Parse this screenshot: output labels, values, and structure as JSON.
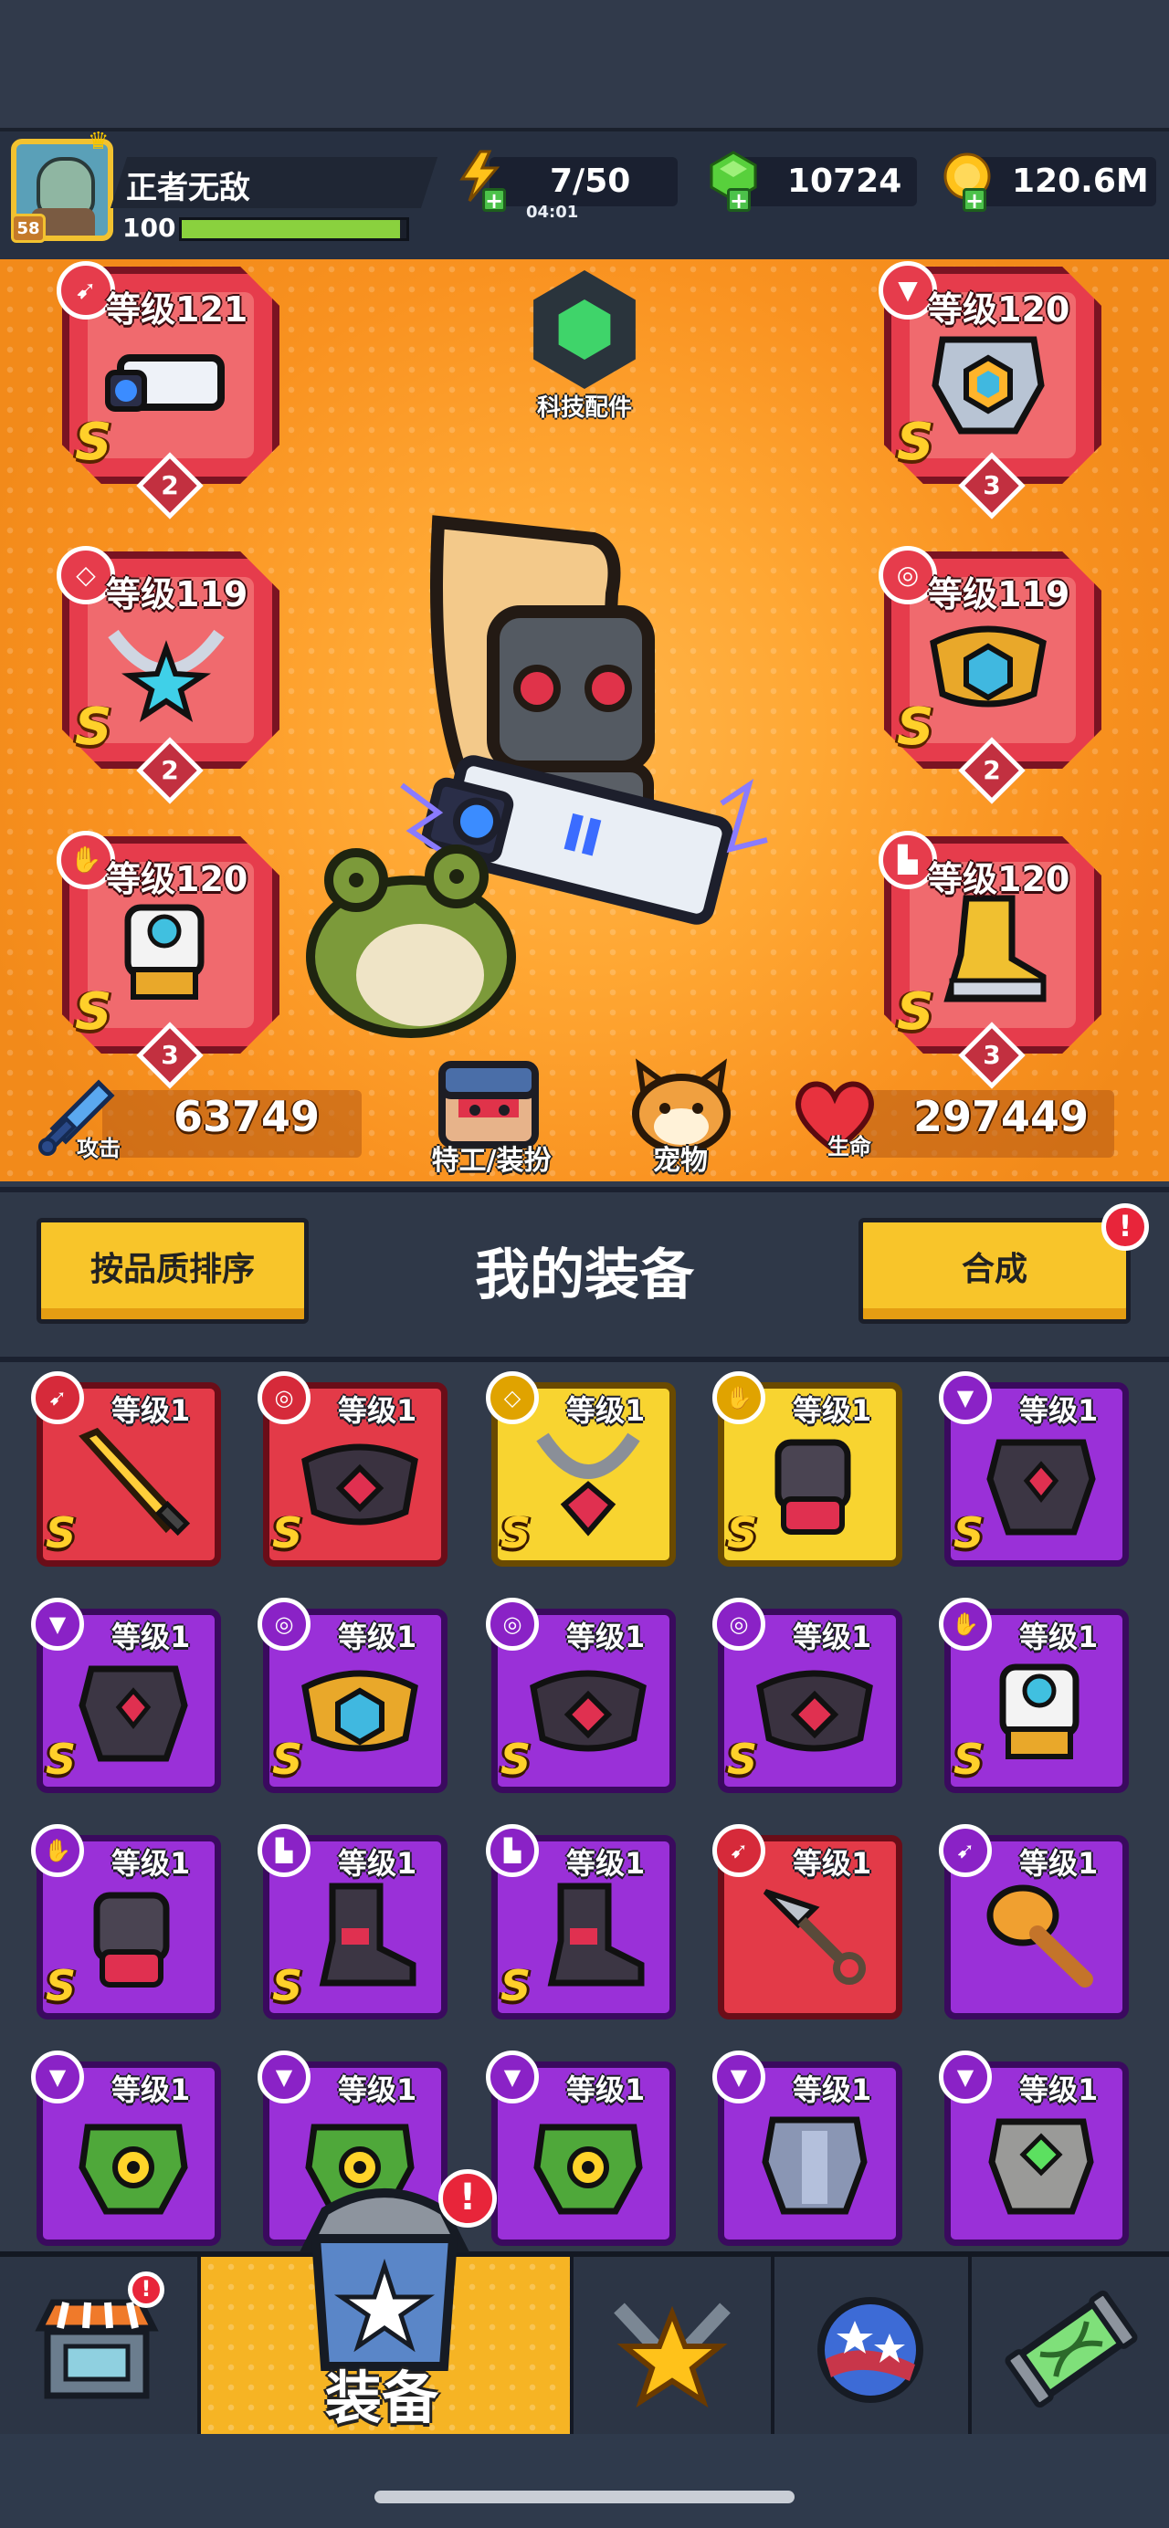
{
  "player": {
    "name": "正者无敌",
    "avatar_level": "58",
    "xp_level": "100",
    "xp_progress": 0.97
  },
  "resources": {
    "energy": "7/50",
    "energy_timer": "04:01",
    "gems": "10724",
    "coins": "120.6M"
  },
  "hero": {
    "tech_label": "科技配件",
    "attack_label": "攻击",
    "attack_value": "63749",
    "agent_label": "特工/装扮",
    "pet_label": "宠物",
    "hp_label": "生命",
    "hp_value": "297449",
    "equipped": [
      {
        "slot": "weapon",
        "icon": "weapon-slot-icon",
        "level": "等级121",
        "rank": "S",
        "stars": "2"
      },
      {
        "slot": "armor",
        "icon": "armor-slot-icon",
        "level": "等级120",
        "rank": "S",
        "stars": "3"
      },
      {
        "slot": "necklace",
        "icon": "necklace-slot-icon",
        "level": "等级119",
        "rank": "S",
        "stars": "2"
      },
      {
        "slot": "belt",
        "icon": "belt-slot-icon",
        "level": "等级119",
        "rank": "S",
        "stars": "2"
      },
      {
        "slot": "gloves",
        "icon": "glove-slot-icon",
        "level": "等级120",
        "rank": "S",
        "stars": "3"
      },
      {
        "slot": "boots",
        "icon": "boot-slot-icon",
        "level": "等级120",
        "rank": "S",
        "stars": "3"
      }
    ]
  },
  "equipment_panel": {
    "sort_button": "按品质排序",
    "title": "我的装备",
    "merge_button": "合成",
    "alert": "!"
  },
  "inventory": [
    {
      "color": "red",
      "slot_icon": "weapon-slot-icon",
      "item": "golden-sword",
      "level": "等级1",
      "rank": "S"
    },
    {
      "color": "red",
      "slot_icon": "belt-slot-icon",
      "item": "dark-belt",
      "level": "等级1",
      "rank": "S"
    },
    {
      "color": "yellow",
      "slot_icon": "necklace-slot-icon",
      "item": "chain-necklace",
      "level": "等级1",
      "rank": "S"
    },
    {
      "color": "yellow",
      "slot_icon": "glove-slot-icon",
      "item": "dark-gauntlet",
      "level": "等级1",
      "rank": "S"
    },
    {
      "color": "purple",
      "slot_icon": "armor-slot-icon",
      "item": "dark-armor",
      "level": "等级1",
      "rank": "S"
    },
    {
      "color": "purple",
      "slot_icon": "armor-slot-icon",
      "item": "dark-armor",
      "level": "等级1",
      "rank": "S"
    },
    {
      "color": "purple",
      "slot_icon": "belt-slot-icon",
      "item": "gold-belt",
      "level": "等级1",
      "rank": "S"
    },
    {
      "color": "purple",
      "slot_icon": "belt-slot-icon",
      "item": "dark-belt",
      "level": "等级1",
      "rank": "S"
    },
    {
      "color": "purple",
      "slot_icon": "belt-slot-icon",
      "item": "dark-belt",
      "level": "等级1",
      "rank": "S"
    },
    {
      "color": "purple",
      "slot_icon": "glove-slot-icon",
      "item": "mech-glove",
      "level": "等级1",
      "rank": "S"
    },
    {
      "color": "purple",
      "slot_icon": "glove-slot-icon",
      "item": "dark-gauntlet",
      "level": "等级1",
      "rank": "S"
    },
    {
      "color": "purple",
      "slot_icon": "boot-slot-icon",
      "item": "dark-boot",
      "level": "等级1",
      "rank": "S"
    },
    {
      "color": "purple",
      "slot_icon": "boot-slot-icon",
      "item": "dark-boot",
      "level": "等级1",
      "rank": "S"
    },
    {
      "color": "red",
      "slot_icon": "weapon-slot-icon",
      "item": "kunai",
      "level": "等级1",
      "rank": ""
    },
    {
      "color": "purple",
      "slot_icon": "weapon-slot-icon",
      "item": "torch",
      "level": "等级1",
      "rank": ""
    },
    {
      "color": "purple",
      "slot_icon": "armor-slot-icon",
      "item": "leaf-armor",
      "level": "等级1",
      "rank": ""
    },
    {
      "color": "purple",
      "slot_icon": "armor-slot-icon",
      "item": "leaf-armor",
      "level": "等级1",
      "rank": ""
    },
    {
      "color": "purple",
      "slot_icon": "armor-slot-icon",
      "item": "leaf-armor",
      "level": "等级1",
      "rank": ""
    },
    {
      "color": "purple",
      "slot_icon": "armor-slot-icon",
      "item": "steel-armor",
      "level": "等级1",
      "rank": ""
    },
    {
      "color": "purple",
      "slot_icon": "armor-slot-icon",
      "item": "stone-armor",
      "level": "等级1",
      "rank": ""
    }
  ],
  "nav": {
    "tabs": [
      {
        "icon": "shop-icon",
        "label": ""
      },
      {
        "icon": "equipment-icon",
        "label": "装备"
      },
      {
        "icon": "battle-icon",
        "label": ""
      },
      {
        "icon": "planet-icon",
        "label": ""
      },
      {
        "icon": "dna-icon",
        "label": ""
      }
    ]
  },
  "colors": {
    "stage_orange": "#f99220",
    "rank_gold": "#ffd02a",
    "quality_red": "#e33a48",
    "quality_yellow": "#f8d430",
    "quality_purple": "#9a30d8",
    "alert_red": "#e8253a"
  }
}
